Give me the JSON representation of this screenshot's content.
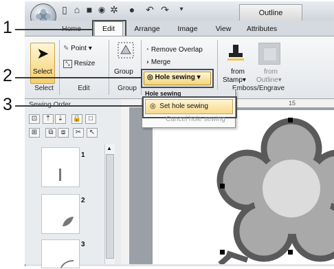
{
  "quick_access": {
    "title": "Outline",
    "icons": [
      "new-icon",
      "open-icon",
      "save-icon",
      "record-icon",
      "stitch-icon",
      "color-icon",
      "undo-icon",
      "redo-icon",
      "more-icon"
    ]
  },
  "tabs": [
    {
      "label": "Home"
    },
    {
      "label": "Edit"
    },
    {
      "label": "Arrange"
    },
    {
      "label": "Image"
    },
    {
      "label": "View"
    },
    {
      "label": "Attributes"
    }
  ],
  "ribbon": {
    "select_group": {
      "button": "Select",
      "label": "Select"
    },
    "edit_group": {
      "point": "Point",
      "resize": "Resize",
      "label": "Edit"
    },
    "group_group": {
      "button": "Group",
      "label": "Group"
    },
    "overlap": {
      "remove_overlap": "Remove Overlap",
      "merge": "Merge",
      "hole_sewing": "Hole sewing"
    },
    "emboss": {
      "from_stamp": "from",
      "stamp": "Stamp",
      "from_outline": "from",
      "outline": "Outline",
      "label": "Emboss/Engrave"
    }
  },
  "dropdown": {
    "header": "Hole sewing",
    "items": [
      {
        "label": "Set hole sewing"
      },
      {
        "label": "Cancel hole sewing"
      }
    ]
  },
  "sewing_order": {
    "title": "Sewing Order",
    "items": [
      {
        "num": "1"
      },
      {
        "num": "2"
      },
      {
        "num": "3"
      }
    ]
  },
  "steps": [
    {
      "num": "1"
    },
    {
      "num": "2"
    },
    {
      "num": "3"
    }
  ],
  "ruler": {
    "mark": "15"
  },
  "colors": {
    "accent": "#f4d47a",
    "flower_outline": "#5a5a5a",
    "flower_fill": "#a9a9a9",
    "flower_center": "#dcdcdc"
  }
}
